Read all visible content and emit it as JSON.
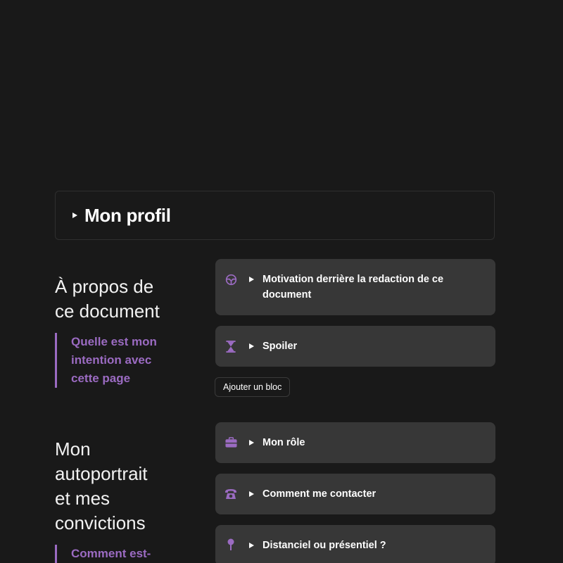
{
  "profile": {
    "title": "Mon profil"
  },
  "sections": [
    {
      "heading_lines": [
        "À propos de",
        "ce document"
      ],
      "quote_lines": [
        "Quelle est mon",
        "intention avec",
        "cette page"
      ],
      "cards": [
        {
          "icon": "steering-wheel-icon",
          "label_lines": [
            "Motivation derrière la redaction de ce",
            "document"
          ]
        },
        {
          "icon": "hourglass-icon",
          "label_lines": [
            "Spoiler"
          ]
        }
      ]
    },
    {
      "heading_lines": [
        "Mon",
        "autoportrait",
        "et mes",
        "convictions"
      ],
      "quote_lines": [
        "Comment est-"
      ],
      "cards": [
        {
          "icon": "briefcase-icon",
          "label_lines": [
            "Mon rôle"
          ]
        },
        {
          "icon": "telephone-icon",
          "label_lines": [
            "Comment me contacter"
          ]
        },
        {
          "icon": "pin-icon",
          "label_lines": [
            "Distanciel ou présentiel ?"
          ]
        }
      ]
    }
  ],
  "add_block": {
    "label": "Ajouter un bloc"
  },
  "colors": {
    "accent": "#9b6bc2",
    "background": "#191919",
    "card": "#373737"
  }
}
